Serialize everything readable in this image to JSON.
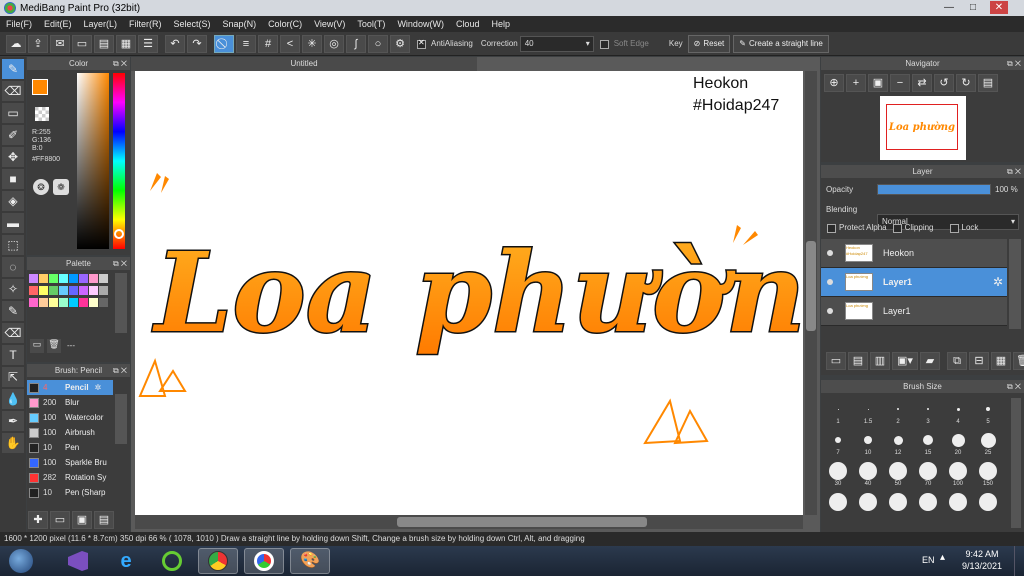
{
  "window": {
    "title": "MediBang Paint Pro (32bit)",
    "minimize": "—",
    "maximize": "□",
    "close": "✕"
  },
  "menu": [
    "File(F)",
    "Edit(E)",
    "Layer(L)",
    "Filter(R)",
    "Select(S)",
    "Snap(N)",
    "Color(C)",
    "View(V)",
    "Tool(T)",
    "Window(W)",
    "Cloud",
    "Help"
  ],
  "toolbar": {
    "antialiasing_label": "AntiAliasing",
    "correction_label": "Correction",
    "correction_value": "40",
    "soft_edge_label": "Soft Edge",
    "key_label": "Key",
    "reset_label": "Reset",
    "straight_line_label": "Create a straight line"
  },
  "tools": [
    "brush-tool",
    "eraser-tool",
    "shape-tool",
    "eyedropper-tool",
    "move-tool",
    "fill-rect-tool",
    "bucket-tool",
    "gradient-tool",
    "select-rect-tool",
    "lasso-tool",
    "magic-wand-tool",
    "select-pen-tool",
    "select-eraser-tool",
    "text-tool",
    "operation-tool",
    "dropper-tool",
    "pen-tool",
    "hand-tool"
  ],
  "color": {
    "title": "Color",
    "r": "R:255",
    "g": "G:136",
    "b": "B:0",
    "hex": "#FF8800",
    "fg": "#ff8800",
    "bg": "#000000"
  },
  "palette": {
    "title": "Palette",
    "colors": [
      "#c8f",
      "#fc6",
      "#6f6",
      "#6ff",
      "#09f",
      "#96f",
      "#f9c",
      "#ccc",
      "#f66",
      "#ff6",
      "#6c6",
      "#6cf",
      "#66f",
      "#c6f",
      "#fcf",
      "#aaa",
      "#f6c",
      "#fc9",
      "#ff9",
      "#9fc",
      "#0cf",
      "#f39",
      "#ffc",
      "#666"
    ],
    "footer": "---"
  },
  "brush": {
    "title": "Brush: Pencil",
    "items": [
      {
        "size": "4",
        "name": "Pencil",
        "color": "#222"
      },
      {
        "size": "200",
        "name": "Blur",
        "color": "#f9c"
      },
      {
        "size": "100",
        "name": "Watercolor",
        "color": "#6cf"
      },
      {
        "size": "100",
        "name": "Airbrush",
        "color": "#ccc"
      },
      {
        "size": "10",
        "name": "Pen",
        "color": "#222"
      },
      {
        "size": "100",
        "name": "Sparkle Bru",
        "color": "#36f"
      },
      {
        "size": "282",
        "name": "Rotation Sy",
        "color": "#f33"
      },
      {
        "size": "10",
        "name": "Pen (Sharp",
        "color": "#222"
      }
    ]
  },
  "canvas": {
    "tab": "Untitled",
    "credit_1": "Heokon",
    "credit_2": "#Hoidap247",
    "art_text": "Loa phường"
  },
  "navigator": {
    "title": "Navigator",
    "thumb_text": "Loa phường"
  },
  "layer": {
    "title": "Layer",
    "opacity_label": "Opacity",
    "opacity_value": "100 %",
    "opacity_fraction": 1.0,
    "blending_label": "Blending",
    "blending_value": "Normal",
    "protect_alpha": "Protect Alpha",
    "clipping": "Clipping",
    "lock": "Lock",
    "rows": [
      {
        "name": "Heokon",
        "thumb": "Heokon #Hoidap247",
        "selected": false
      },
      {
        "name": "Layer1",
        "thumb": "Loa phường",
        "selected": true
      },
      {
        "name": "Layer1",
        "thumb": "Loa phường",
        "selected": false
      }
    ]
  },
  "brushsize": {
    "title": "Brush Size",
    "sizes": [
      "1",
      "1.5",
      "2",
      "3",
      "4",
      "5",
      "7",
      "10",
      "12",
      "15",
      "20",
      "25",
      "30",
      "40",
      "50",
      "70",
      "100",
      "150",
      "",
      "",
      "",
      "",
      "",
      ""
    ]
  },
  "status": {
    "text": "1600 * 1200 pixel   (11.6 * 8.7cm)   350 dpi   66 %   ( 1078, 1010 )   Draw a straight line by holding down Shift, Change a brush size by holding down Ctrl, Alt, and dragging"
  },
  "taskbar": {
    "lang": "EN",
    "time": "9:42 AM",
    "date": "9/13/2021"
  }
}
